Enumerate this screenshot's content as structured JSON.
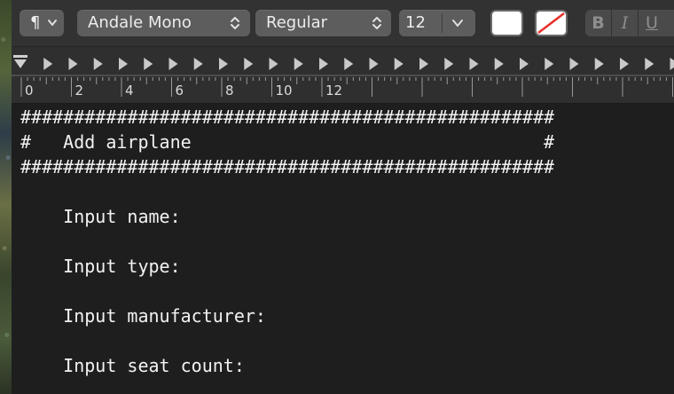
{
  "toolbar": {
    "paragraph_symbol": "¶",
    "font_family": "Andale Mono",
    "font_style": "Regular",
    "font_size": "12",
    "bold": "B",
    "italic": "I",
    "underline": "U",
    "text_color": "#ffffff",
    "background_color": "none"
  },
  "ruler": {
    "labels": [
      "0",
      "2",
      "4",
      "6",
      "8",
      "10",
      "12"
    ]
  },
  "document": {
    "lines": [
      "##################################################",
      "#   Add airplane                                 #",
      "##################################################",
      "",
      "    Input name:",
      "",
      "    Input type:",
      "",
      "    Input manufacturer:",
      "",
      "    Input seat count:"
    ]
  }
}
